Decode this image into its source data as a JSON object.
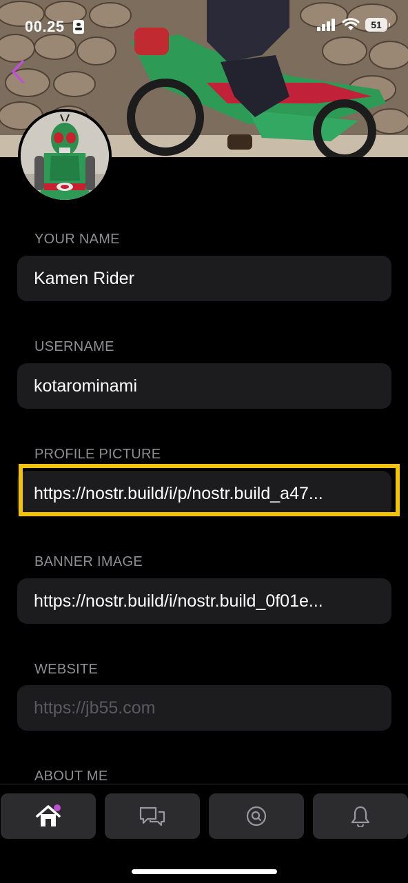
{
  "status_bar": {
    "time": "00.25",
    "battery": "51"
  },
  "form": {
    "name": {
      "label": "YOUR NAME",
      "value": "Kamen Rider"
    },
    "username": {
      "label": "USERNAME",
      "value": "kotarominami"
    },
    "profile_picture": {
      "label": "PROFILE PICTURE",
      "value": "https://nostr.build/i/p/nostr.build_a47..."
    },
    "banner_image": {
      "label": "BANNER IMAGE",
      "value": "https://nostr.build/i/nostr.build_0f01e..."
    },
    "website": {
      "label": "WEBSITE",
      "placeholder": "https://jb55.com"
    },
    "about": {
      "label": "ABOUT ME"
    }
  },
  "tab_bar": {
    "tabs": [
      {
        "icon": "home-icon",
        "badge": true
      },
      {
        "icon": "chat-bubbles-icon"
      },
      {
        "icon": "search-icon"
      },
      {
        "icon": "bell-icon"
      }
    ]
  },
  "colors": {
    "accent": "#bf4fd6",
    "highlight": "#f5c400",
    "field_bg": "#1c1c1e",
    "label": "#8e8e93"
  }
}
